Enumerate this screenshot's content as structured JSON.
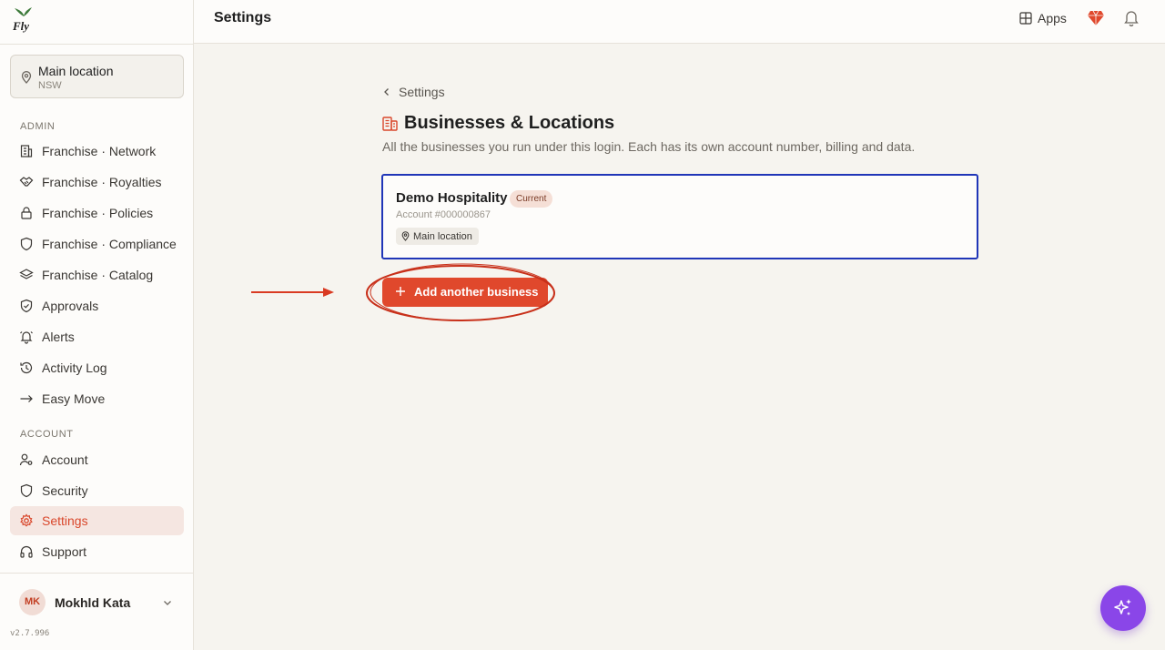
{
  "app": {
    "logo_text": "Fly"
  },
  "sidebar": {
    "location": {
      "name": "Main location",
      "sub": "NSW"
    },
    "sections": {
      "admin": "ADMIN",
      "account": "ACCOUNT"
    },
    "items": [
      {
        "label": "Franchise · Network",
        "icon": "building-icon"
      },
      {
        "label": "Franchise · Royalties",
        "icon": "handshake-icon"
      },
      {
        "label": "Franchise · Policies",
        "icon": "lock-icon"
      },
      {
        "label": "Franchise · Compliance",
        "icon": "shield-icon"
      },
      {
        "label": "Franchise · Catalog",
        "icon": "layers-icon"
      },
      {
        "label": "Approvals",
        "icon": "shield-check-icon"
      },
      {
        "label": "Alerts",
        "icon": "bell-ring-icon"
      },
      {
        "label": "Activity Log",
        "icon": "history-icon"
      },
      {
        "label": "Easy Move",
        "icon": "arrow-right-icon"
      },
      {
        "label": "Account",
        "icon": "user-cog-icon"
      },
      {
        "label": "Security",
        "icon": "shield-icon"
      },
      {
        "label": "Settings",
        "icon": "gear-icon",
        "active": true
      },
      {
        "label": "Support",
        "icon": "headphones-icon"
      }
    ],
    "user": {
      "initials": "MK",
      "name": "Mokhld Kata"
    },
    "version": "v2.7.996"
  },
  "topbar": {
    "title": "Settings",
    "apps_label": "Apps"
  },
  "main": {
    "back_label": "Settings",
    "title": "Businesses & Locations",
    "description": "All the businesses you run under this login. Each has its own account number, billing and data.",
    "business": {
      "name": "Demo Hospitality",
      "badge": "Current",
      "account": "Account #000000867",
      "location": "Main location"
    },
    "add_button": "Add another business"
  },
  "colors": {
    "accent": "#e0482c",
    "selection": "#2036b8",
    "fab": "#8a46e8"
  }
}
